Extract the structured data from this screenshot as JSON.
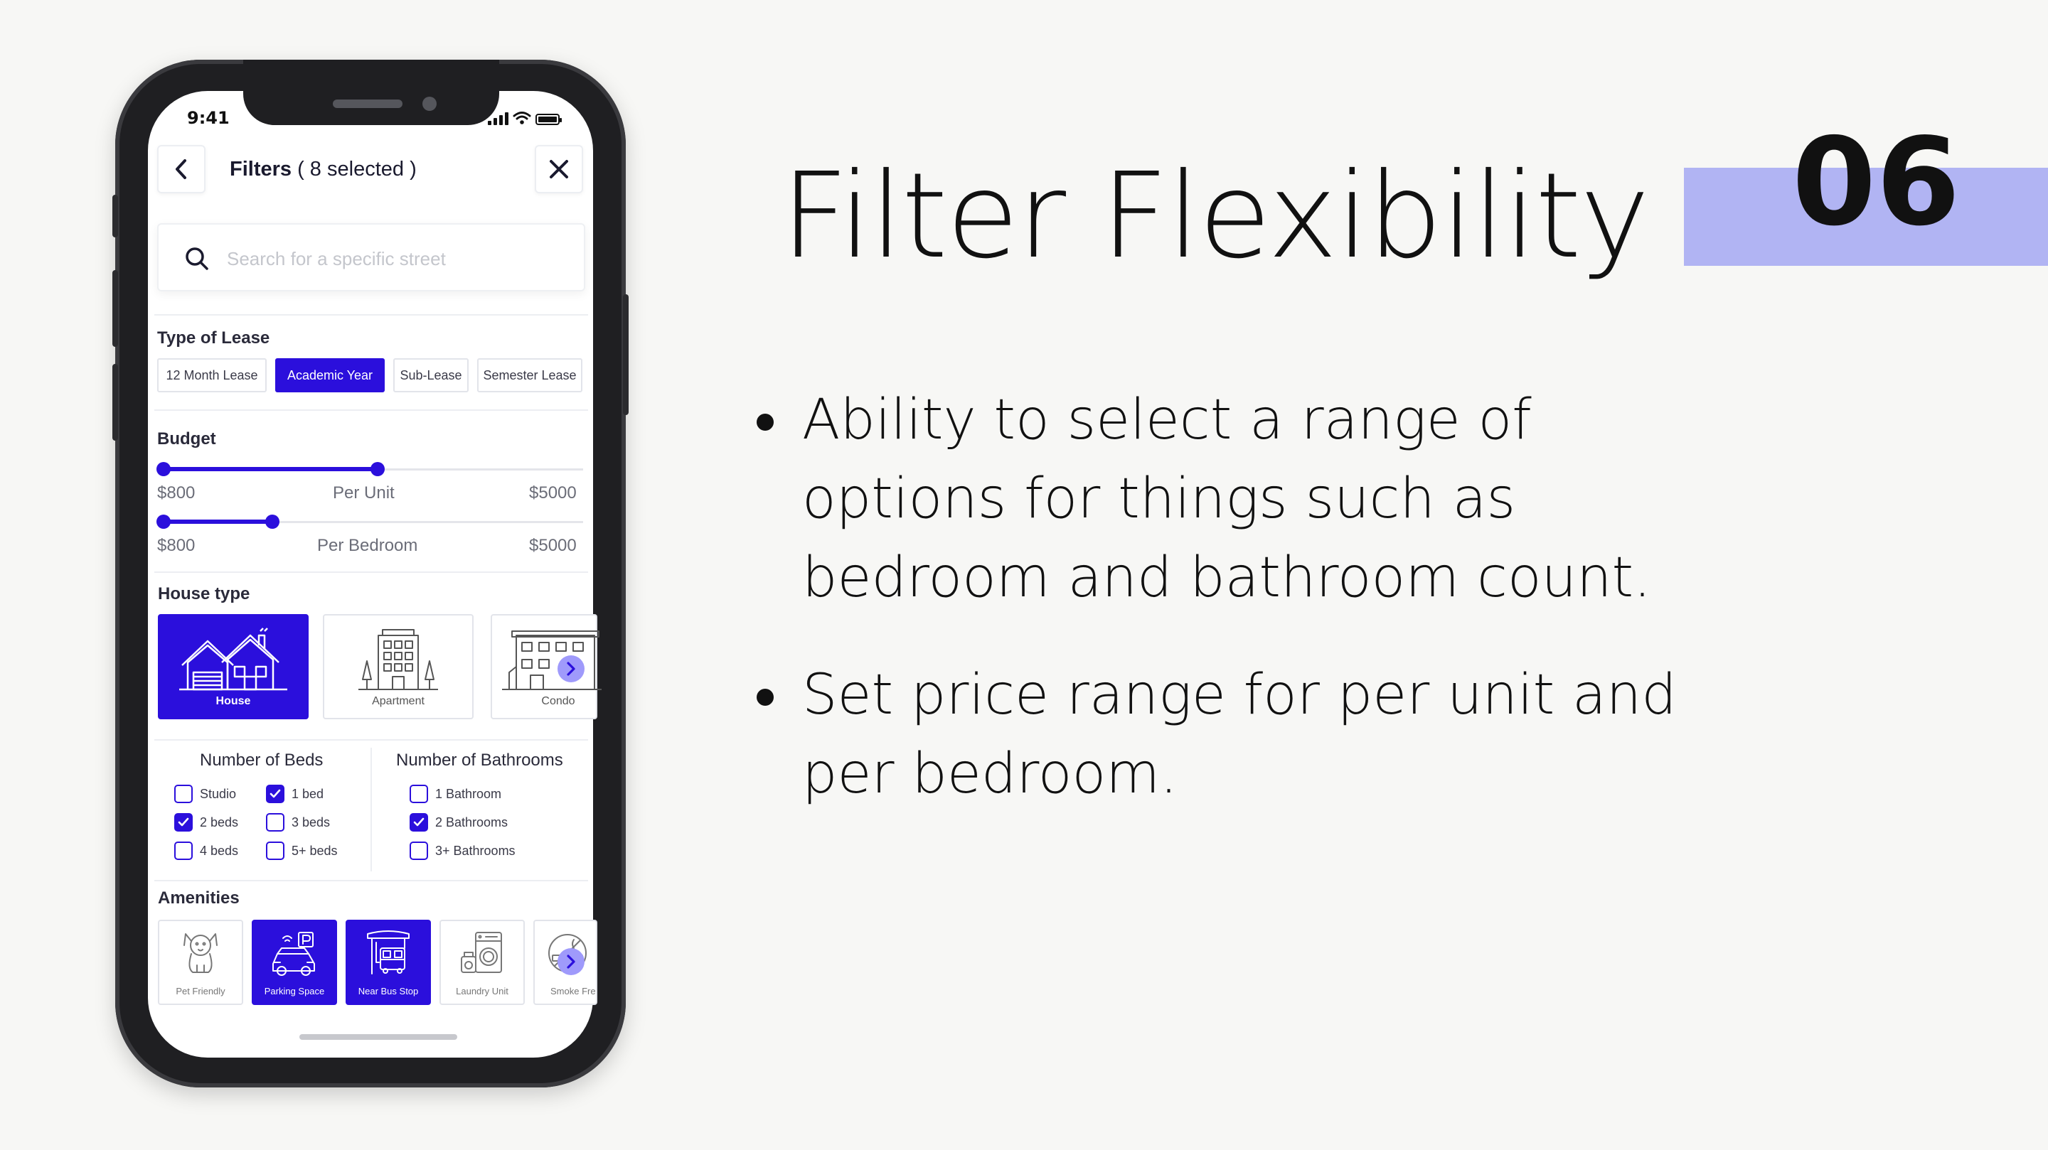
{
  "phone": {
    "status_time": "9:41",
    "header": {
      "title": "Filters",
      "selected": "( 8 selected )"
    },
    "search": {
      "placeholder": "Search for a specific street",
      "value": ""
    },
    "lease": {
      "label": "Type of Lease",
      "options": [
        "12 Month Lease",
        "Academic Year",
        "Sub-Lease",
        "Semester Lease"
      ],
      "selected": "Academic Year"
    },
    "budget": {
      "label": "Budget",
      "per_unit": {
        "min": "$800",
        "label": "Per Unit",
        "max": "$5000",
        "fill_fraction": 0.51
      },
      "per_bedroom": {
        "min": "$800",
        "label": "Per Bedroom",
        "max": "$5000",
        "fill_fraction": 0.26
      }
    },
    "house_type": {
      "label": "House type",
      "options": [
        "House",
        "Apartment",
        "Condo"
      ],
      "selected": "House"
    },
    "beds": {
      "label": "Number of Beds",
      "options": [
        {
          "label": "Studio",
          "checked": false
        },
        {
          "label": "1 bed",
          "checked": true
        },
        {
          "label": "2 beds",
          "checked": true
        },
        {
          "label": "3 beds",
          "checked": false
        },
        {
          "label": "4 beds",
          "checked": false
        },
        {
          "label": "5+ beds",
          "checked": false
        }
      ]
    },
    "baths": {
      "label": "Number of Bathrooms",
      "options": [
        {
          "label": "1 Bathroom",
          "checked": false
        },
        {
          "label": "2 Bathrooms",
          "checked": true
        },
        {
          "label": "3+ Bathrooms",
          "checked": false
        }
      ]
    },
    "amenities": {
      "label": "Amenities",
      "options": [
        "Pet Friendly",
        "Parking Space",
        "Near Bus Stop",
        "Laundry Unit",
        "Smoke Fre"
      ],
      "selected": [
        "Parking Space",
        "Near Bus Stop"
      ]
    }
  },
  "slide": {
    "title": "Filter Flexibility",
    "number": "06",
    "bullets": [
      "Ability to select a range of options for things such as bedroom and bathroom count.",
      "Set price range for per unit and per bedroom."
    ]
  },
  "colors": {
    "accent": "#2b0fdc",
    "band": "#b1b4f3",
    "background": "#f7f7f5"
  }
}
